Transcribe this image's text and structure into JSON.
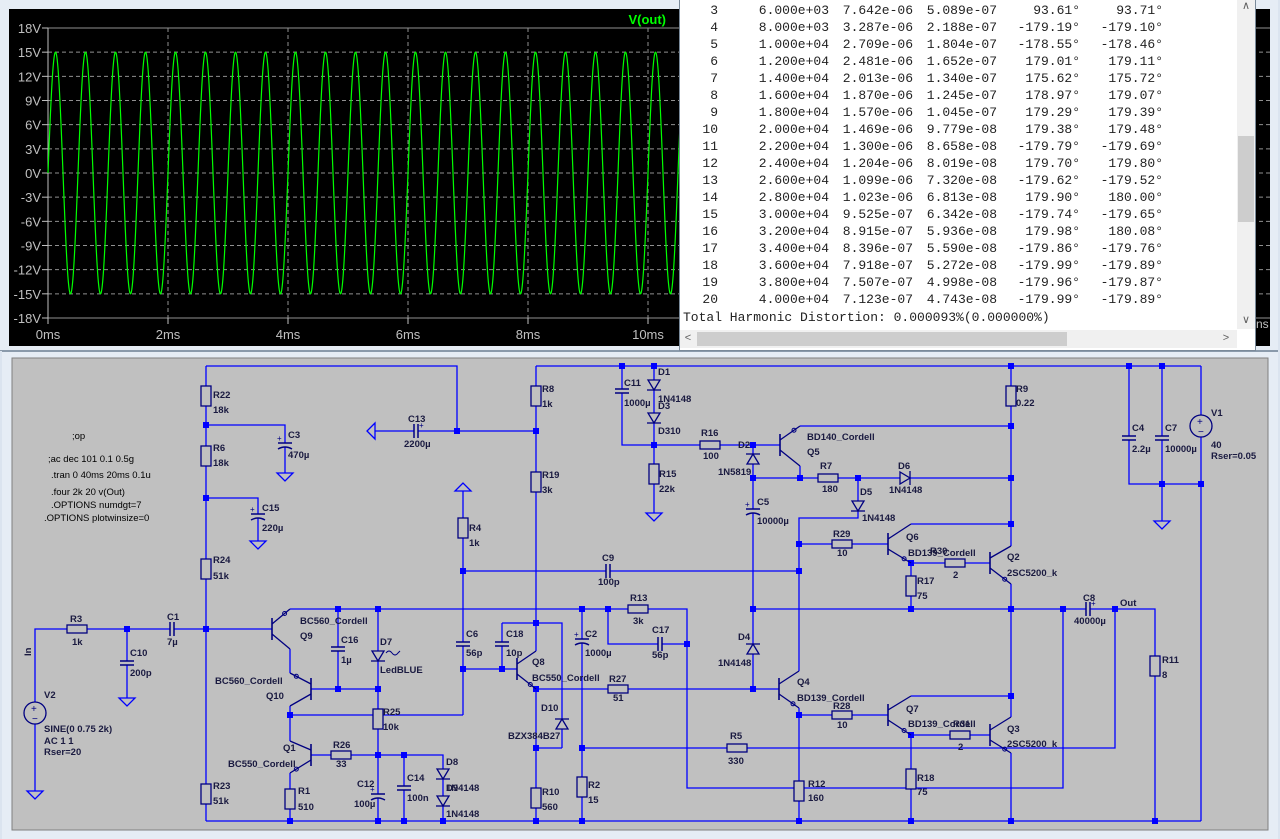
{
  "plot": {
    "trace_label": "V(out)",
    "trace_color": "#00ff00",
    "amplitude_V": 15,
    "frequency_Hz": 2000,
    "y_ticks": [
      "18V",
      "15V",
      "12V",
      "9V",
      "6V",
      "3V",
      "0V",
      "-3V",
      "-6V",
      "-9V",
      "-12V",
      "-15V",
      "-18V"
    ],
    "y_range_V": [
      -18,
      18
    ],
    "x_ticks": [
      "0ms",
      "2ms",
      "4ms",
      "6ms",
      "8ms",
      "10ms"
    ],
    "x_cut_label": "ns",
    "grid": true
  },
  "fourier_table": {
    "rows": [
      [
        "3",
        "6.000e+03",
        "7.642e-06",
        "5.089e-07",
        "93.61°",
        "93.71°"
      ],
      [
        "4",
        "8.000e+03",
        "3.287e-06",
        "2.188e-07",
        "-179.19°",
        "-179.10°"
      ],
      [
        "5",
        "1.000e+04",
        "2.709e-06",
        "1.804e-07",
        "-178.55°",
        "-178.46°"
      ],
      [
        "6",
        "1.200e+04",
        "2.481e-06",
        "1.652e-07",
        "179.01°",
        "179.11°"
      ],
      [
        "7",
        "1.400e+04",
        "2.013e-06",
        "1.340e-07",
        "175.62°",
        "175.72°"
      ],
      [
        "8",
        "1.600e+04",
        "1.870e-06",
        "1.245e-07",
        "178.97°",
        "179.07°"
      ],
      [
        "9",
        "1.800e+04",
        "1.570e-06",
        "1.045e-07",
        "179.29°",
        "179.39°"
      ],
      [
        "10",
        "2.000e+04",
        "1.469e-06",
        "9.779e-08",
        "179.38°",
        "179.48°"
      ],
      [
        "11",
        "2.200e+04",
        "1.300e-06",
        "8.658e-08",
        "-179.79°",
        "-179.69°"
      ],
      [
        "12",
        "2.400e+04",
        "1.204e-06",
        "8.019e-08",
        "179.70°",
        "179.80°"
      ],
      [
        "13",
        "2.600e+04",
        "1.099e-06",
        "7.320e-08",
        "-179.62°",
        "-179.52°"
      ],
      [
        "14",
        "2.800e+04",
        "1.023e-06",
        "6.813e-08",
        "179.90°",
        "180.00°"
      ],
      [
        "15",
        "3.000e+04",
        "9.525e-07",
        "6.342e-08",
        "-179.74°",
        "-179.65°"
      ],
      [
        "16",
        "3.200e+04",
        "8.915e-07",
        "5.936e-08",
        "179.98°",
        "180.08°"
      ],
      [
        "17",
        "3.400e+04",
        "8.396e-07",
        "5.590e-08",
        "-179.86°",
        "-179.76°"
      ],
      [
        "18",
        "3.600e+04",
        "7.918e-07",
        "5.272e-08",
        "-179.99°",
        "-179.89°"
      ],
      [
        "19",
        "3.800e+04",
        "7.507e-07",
        "4.998e-08",
        "-179.96°",
        "-179.87°"
      ],
      [
        "20",
        "4.000e+04",
        "7.123e-07",
        "4.743e-08",
        "-179.99°",
        "-179.89°"
      ]
    ],
    "thd": "Total Harmonic Distortion: 0.000093%(0.000000%)"
  },
  "schematic": {
    "wire_color": "#0000ff",
    "directives": [
      ";op",
      ";ac dec 101 0.1 0.5g",
      ".tran 0 40ms 20ms 0.1u",
      ".four 2k 20 v(Out)",
      ".OPTIONS numdgt=7",
      ".OPTIONS plotwinsize=0"
    ],
    "net_labels": {
      "in": "In",
      "out": "Out"
    },
    "parts": {
      "R22": [
        "R22",
        "18k"
      ],
      "R6": [
        "R6",
        "18k"
      ],
      "R24": [
        "R24",
        "51k"
      ],
      "R23": [
        "R23",
        "51k"
      ],
      "R3": [
        "R3",
        "1k"
      ],
      "R1": [
        "R1",
        "510"
      ],
      "R25": [
        "R25",
        "10k"
      ],
      "R26": [
        "R26",
        "33"
      ],
      "R8": [
        "R8",
        "1k"
      ],
      "R19": [
        "R19",
        "3k"
      ],
      "R4": [
        "R4",
        "1k"
      ],
      "R15": [
        "R15",
        "22k"
      ],
      "R16": [
        "R16",
        "100"
      ],
      "R7": [
        "R7",
        "180"
      ],
      "R29": [
        "R29",
        "10"
      ],
      "R30": [
        "R30",
        "2"
      ],
      "R13": [
        "R13",
        "3k"
      ],
      "R27": [
        "R27",
        "51"
      ],
      "R5": [
        "R5",
        "330"
      ],
      "R10": [
        "R10",
        "560"
      ],
      "R2": [
        "R2",
        "15"
      ],
      "R12": [
        "R12",
        "160"
      ],
      "R28": [
        "R28",
        "10"
      ],
      "R31": [
        "R31",
        "2"
      ],
      "R17": [
        "R17",
        "75"
      ],
      "R18": [
        "R18",
        "75"
      ],
      "R9": [
        "R9",
        "0.22"
      ],
      "R11": [
        "R11",
        "8"
      ],
      "C3": [
        "C3",
        "470µ"
      ],
      "C15": [
        "C15",
        "220µ"
      ],
      "C13": [
        "C13",
        "2200µ"
      ],
      "C10": [
        "C10",
        "200p"
      ],
      "C1": [
        "C1",
        "7µ"
      ],
      "C16": [
        "C16",
        "1µ"
      ],
      "C12": [
        "C12",
        "100µ"
      ],
      "C14": [
        "C14",
        "100n"
      ],
      "C11": [
        "C11",
        "1000µ"
      ],
      "C9": [
        "C9",
        "100p"
      ],
      "C5": [
        "C5",
        "10000µ"
      ],
      "C6": [
        "C6",
        "56p"
      ],
      "C18": [
        "C18",
        "10p"
      ],
      "C2": [
        "C2",
        "1000µ"
      ],
      "C17": [
        "C17",
        "56p"
      ],
      "C8": [
        "C8",
        "40000µ"
      ],
      "C4": [
        "C4",
        "2.2µ"
      ],
      "C7": [
        "C7",
        "10000µ"
      ],
      "D1": [
        "D1",
        "1N4148"
      ],
      "D3": [
        "D3",
        "D310"
      ],
      "D2": [
        "D2",
        "1N5819"
      ],
      "D6": [
        "D6",
        "1N4148"
      ],
      "D5": [
        "D5",
        "1N4148"
      ],
      "D7": [
        "D7",
        "LedBLUE"
      ],
      "D8": [
        "D8",
        "1N4148"
      ],
      "D9": [
        "D9",
        "1N4148"
      ],
      "D10": [
        "D10",
        "BZX384B27"
      ],
      "D4": [
        "D4",
        "1N4148"
      ],
      "Q9": [
        "Q9",
        "BC560_Cordell"
      ],
      "Q10": [
        "Q10",
        "BC560_Cordell"
      ],
      "Q1": [
        "Q1",
        "BC550_Cordell"
      ],
      "Q8": [
        "Q8",
        "BC550_Cordell"
      ],
      "Q5": [
        "Q5",
        "BD140_Cordell"
      ],
      "Q4": [
        "Q4",
        "BD139_Cordell"
      ],
      "Q6": [
        "Q6",
        "BD139_Cordell"
      ],
      "Q7": [
        "Q7",
        "BD139_Cordell"
      ],
      "Q2": [
        "Q2",
        "2SC5200_k"
      ],
      "Q3": [
        "Q3",
        "2SC5200_k"
      ],
      "V1": [
        "V1",
        "40",
        "Rser=0.05"
      ],
      "V2": [
        "V2",
        "SINE(0 0.75 2k)",
        "AC 1 1",
        "Rser=20"
      ]
    }
  }
}
